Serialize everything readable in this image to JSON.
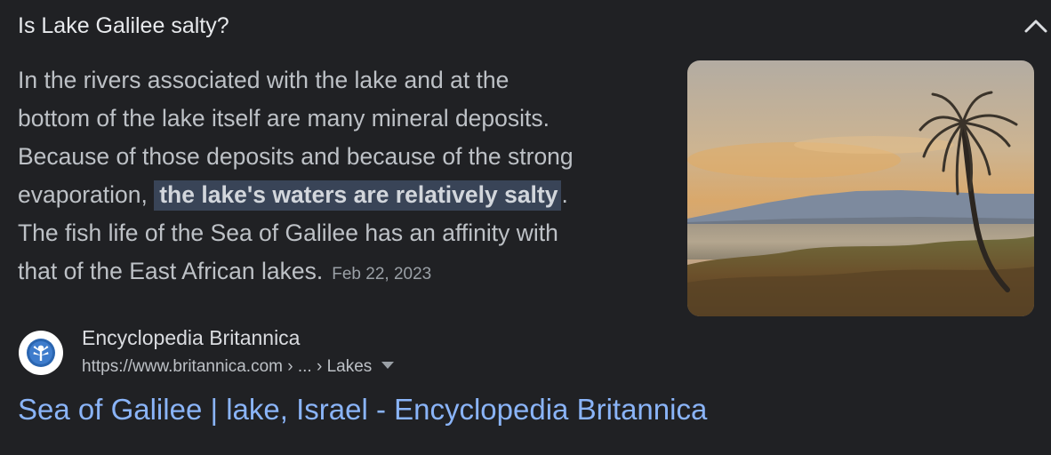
{
  "question": "Is Lake Galilee salty?",
  "collapse_icon": "chevron-up-icon",
  "snippet": {
    "line1": "In the rivers associated with the lake and at the",
    "line2": "bottom of the lake itself are many mineral deposits.",
    "line3": "Because of those deposits and because of the strong",
    "line4_prefix": "evaporation,",
    "highlight": "the lake's waters are relatively salty",
    "line4_suffix": ".",
    "line5": "The fish life of the Sea of Galilee has an affinity with",
    "line6": "that of the East African lakes.",
    "date": "Feb 22, 2023"
  },
  "source": {
    "name": "Encyclopedia Britannica",
    "url": "https://www.britannica.com › ... › Lakes",
    "favicon": "britannica-thistle-icon"
  },
  "result_title": "Sea of Galilee | lake, Israel - Encyclopedia Britannica",
  "colors": {
    "background": "#202124",
    "link": "#8ab4f8",
    "highlight_bg": "#394457",
    "text": "#bdc1c6"
  }
}
